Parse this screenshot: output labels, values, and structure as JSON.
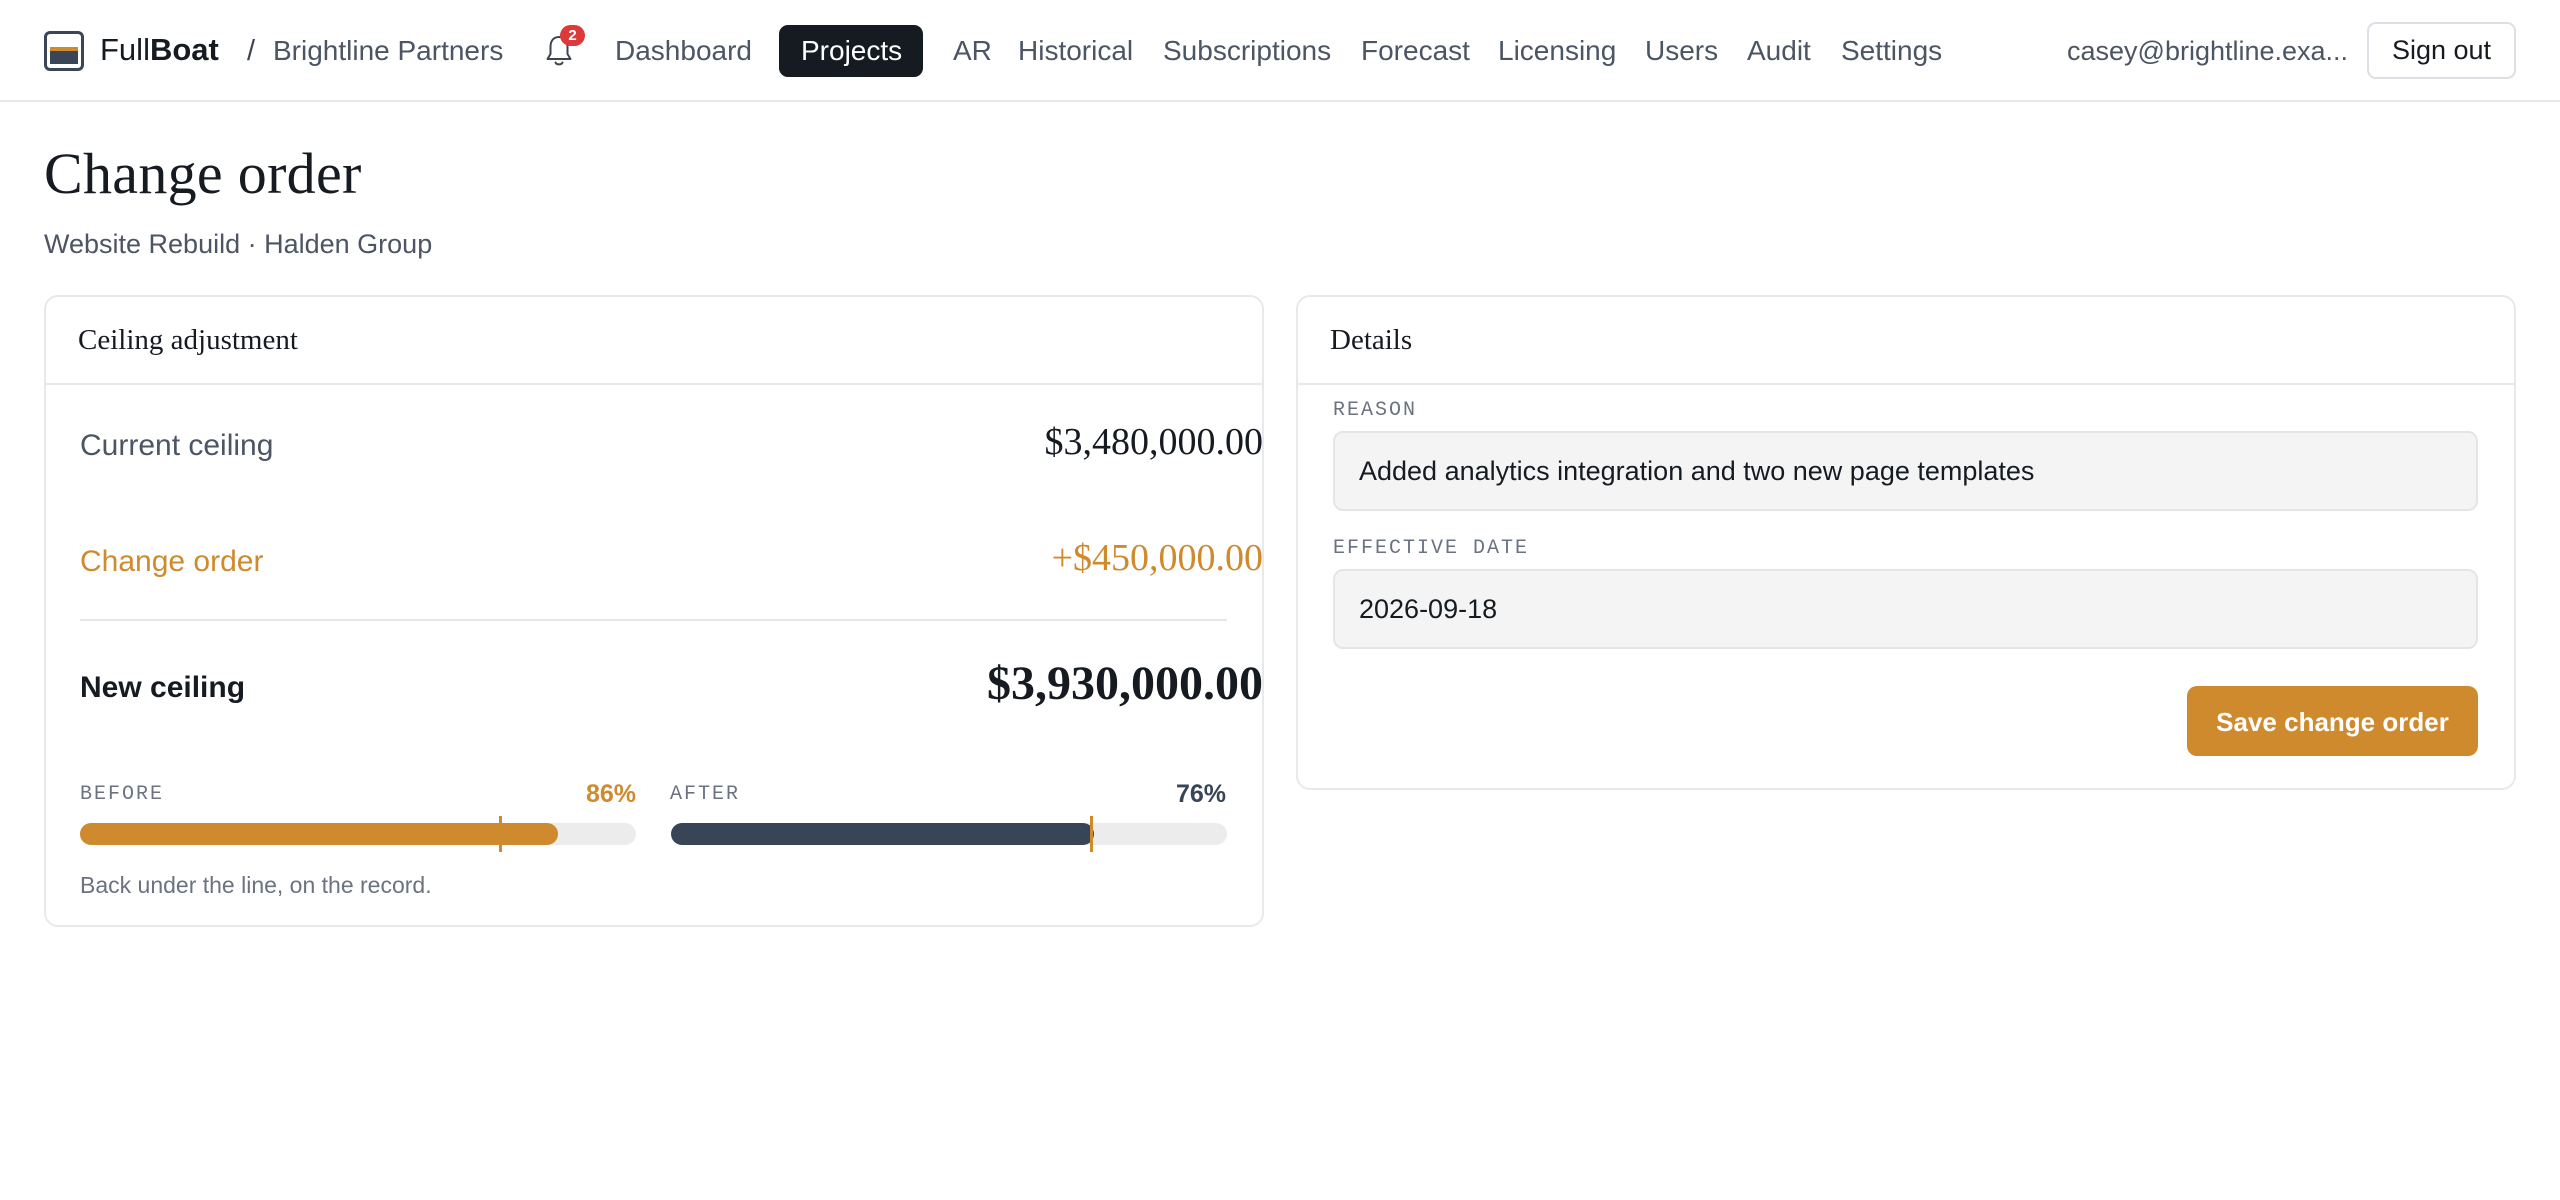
{
  "app": {
    "brand_light": "Full",
    "brand_bold": "Boat",
    "org": "Brightline Partners",
    "notifications_count": "2"
  },
  "nav": {
    "items": [
      {
        "label": "Dashboard"
      },
      {
        "label": "Projects",
        "active": true
      },
      {
        "label": "AR"
      },
      {
        "label": "Historical"
      },
      {
        "label": "Subscriptions"
      },
      {
        "label": "Forecast"
      },
      {
        "label": "Licensing"
      },
      {
        "label": "Users"
      },
      {
        "label": "Audit"
      },
      {
        "label": "Settings"
      }
    ]
  },
  "user": {
    "email": "casey@brightline.exa...",
    "signout_label": "Sign out"
  },
  "page": {
    "title": "Change order",
    "subtitle": "Website Rebuild · Halden Group"
  },
  "ceiling": {
    "card_title": "Ceiling adjustment",
    "current_label": "Current ceiling",
    "current_value": "$3,480,000.00",
    "change_label": "Change order",
    "change_value": "+$450,000.00",
    "new_label": "New ceiling",
    "new_value": "$3,930,000.00",
    "before_label": "BEFORE",
    "before_pct": "86%",
    "before_fraction": 0.86,
    "after_label": "AFTER",
    "after_pct": "76%",
    "after_fraction": 0.76,
    "threshold_fraction": 0.755,
    "note": "Back under the line, on the record."
  },
  "details": {
    "card_title": "Details",
    "reason_label": "REASON",
    "reason_value": "Added analytics integration and two new page templates",
    "date_label": "EFFECTIVE DATE",
    "date_value": "2026-09-18",
    "save_label": "Save change order"
  },
  "colors": {
    "accent": "#cf8a2e",
    "navy": "#374557",
    "dark": "#161b22",
    "danger": "#dc3a3a"
  }
}
